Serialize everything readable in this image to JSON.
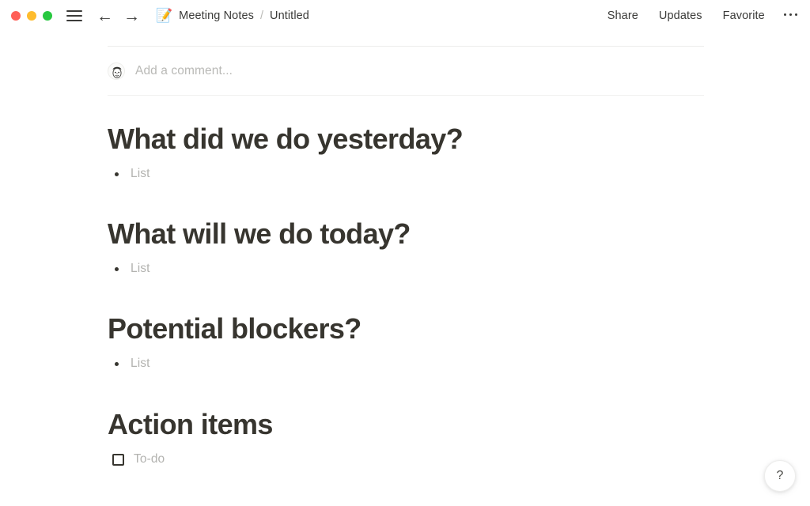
{
  "window": {
    "traffic_lights": [
      {
        "name": "close",
        "color": "#ff5f57"
      },
      {
        "name": "minimize",
        "color": "#febc2e"
      },
      {
        "name": "zoom",
        "color": "#28c840"
      }
    ],
    "menu_icon": "hamburger-icon",
    "back_arrow": "←",
    "forward_arrow": "→",
    "page_emoji": "📝",
    "breadcrumb": {
      "parent": "Meeting Notes",
      "separator": "/",
      "current": "Untitled"
    },
    "actions": [
      "Share",
      "Updates",
      "Favorite"
    ],
    "overflow_label": "•••"
  },
  "comment": {
    "placeholder": "Add a comment...",
    "avatar_alt": "user-avatar"
  },
  "document": {
    "sections": [
      {
        "heading": "What did we do yesterday?",
        "item_type": "bullet",
        "item_text": "List"
      },
      {
        "heading": "What will we do today?",
        "item_type": "bullet",
        "item_text": "List"
      },
      {
        "heading": "Potential blockers?",
        "item_type": "bullet",
        "item_text": "List"
      },
      {
        "heading": "Action items",
        "item_type": "todo",
        "item_text": "To-do"
      }
    ]
  },
  "help": {
    "label": "?"
  },
  "colors": {
    "text_primary": "#37352f",
    "text_placeholder": "#b3b3b0",
    "divider": "#ededec",
    "background": "#ffffff"
  }
}
